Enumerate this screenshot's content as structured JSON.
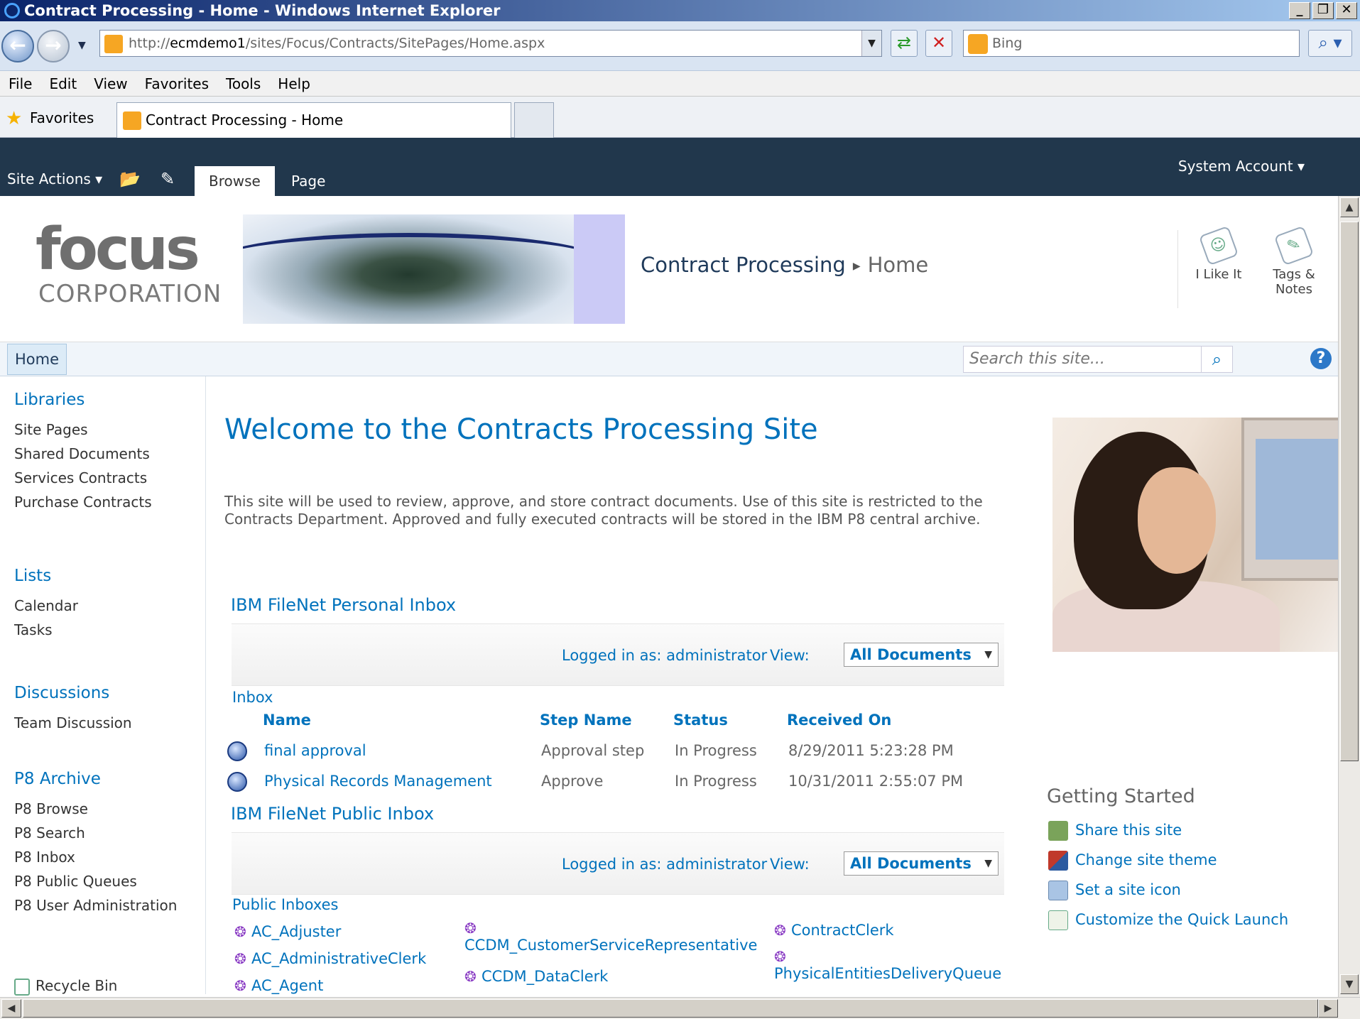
{
  "window": {
    "title": "Contract Processing - Home - Windows Internet Explorer",
    "controls": [
      "_",
      "❐",
      "✕"
    ]
  },
  "address": {
    "url_prefix": "http://",
    "url_host": "ecmdemo1",
    "url_path": "/sites/Focus/Contracts/SitePages/Home.aspx",
    "search_placeholder": "Bing"
  },
  "menu": [
    "File",
    "Edit",
    "View",
    "Favorites",
    "Tools",
    "Help"
  ],
  "favorites": {
    "label": "Favorites",
    "tab_title": "Contract Processing - Home"
  },
  "ribbon": {
    "site_actions": "Site Actions",
    "tab_browse": "Browse",
    "tab_page": "Page",
    "user": "System Account"
  },
  "header": {
    "logo_focus": "focus",
    "logo_corp": "CORPORATION",
    "breadcrumb_site": "Contract Processing",
    "breadcrumb_page": "Home",
    "i_like_it": "I Like It",
    "tags_notes_1": "Tags &",
    "tags_notes_2": "Notes"
  },
  "topnav": {
    "home": "Home",
    "search_placeholder": "Search this site..."
  },
  "leftnav": {
    "libraries": "Libraries",
    "library_items": [
      "Site Pages",
      "Shared Documents",
      "Services Contracts",
      "Purchase Contracts"
    ],
    "lists": "Lists",
    "list_items": [
      "Calendar",
      "Tasks"
    ],
    "discussions": "Discussions",
    "discussion_items": [
      "Team Discussion"
    ],
    "p8": "P8 Archive",
    "p8_items": [
      "P8 Browse",
      "P8 Search",
      "P8 Inbox",
      "P8 Public Queues",
      "P8 User Administration"
    ],
    "recycle_bin": "Recycle Bin"
  },
  "main": {
    "welcome": "Welcome to the Contracts Processing Site",
    "intro": "This site will be used to review, approve, and store contract documents.  Use of this site is restricted to the Contracts Department.  Approved and fully executed contracts will be stored in the IBM P8 central archive.",
    "personal_inbox": {
      "title": "IBM FileNet Personal Inbox",
      "logged_in": "Logged in as: administrator",
      "view_label": "View:",
      "view_value": "All Documents",
      "section": "Inbox",
      "columns": [
        "Name",
        "Step Name",
        "Status",
        "Received On"
      ],
      "rows": [
        {
          "name": "final approval",
          "step": "Approval step",
          "status": "In Progress",
          "received": "8/29/2011 5:23:28 PM"
        },
        {
          "name": "Physical Records Management",
          "step": "Approve",
          "status": "In Progress",
          "received": "10/31/2011 2:55:07 PM"
        }
      ]
    },
    "public_inbox": {
      "title": "IBM FileNet Public Inbox",
      "logged_in": "Logged in as: administrator",
      "view_label": "View:",
      "view_value": "All Documents",
      "section": "Public Inboxes",
      "queues": [
        "AC_Adjuster",
        "AC_AdministrativeClerk",
        "AC_Agent",
        "CCDM_CustomerServiceRepresentative",
        "CCDM_DataClerk",
        "ContractClerk",
        "PhysicalEntitiesDeliveryQueue"
      ]
    }
  },
  "getting_started": {
    "title": "Getting Started",
    "items": [
      "Share this site",
      "Change site theme",
      "Set a site icon",
      "Customize the Quick Launch"
    ]
  }
}
